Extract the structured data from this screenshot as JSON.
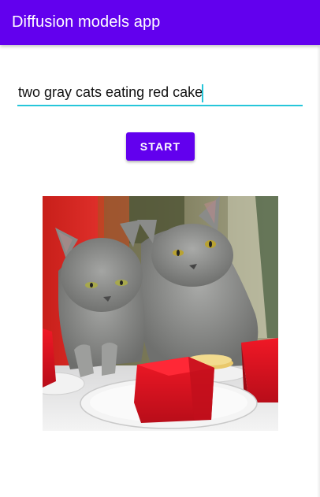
{
  "app_bar": {
    "title": "Diffusion models app"
  },
  "prompt": {
    "value": "two gray cats eating red cake"
  },
  "actions": {
    "start_label": "START"
  },
  "colors": {
    "primary": "#6200ee",
    "accent": "#26c6da",
    "background": "#ffffff"
  },
  "result": {
    "subject": "generated image"
  }
}
